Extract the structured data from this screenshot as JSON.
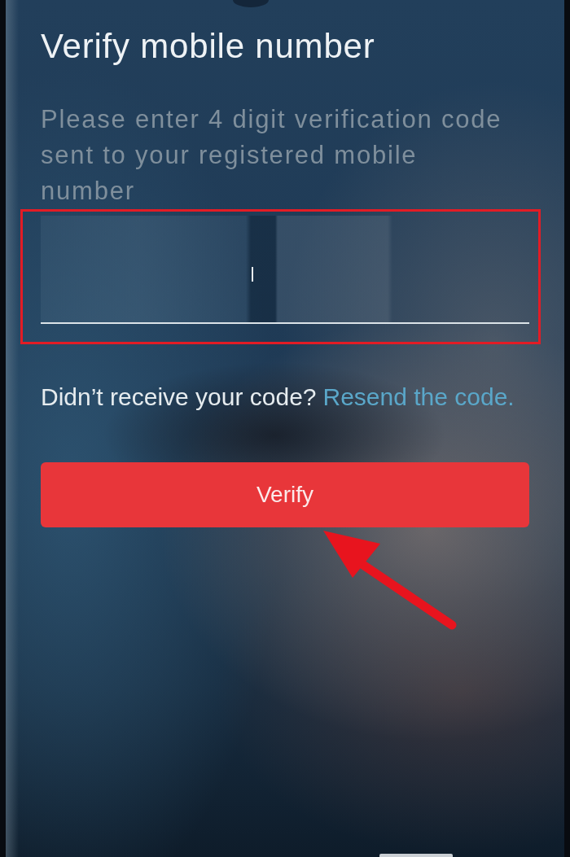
{
  "screen": {
    "title": "Verify mobile number",
    "instructions": "Please enter 4 digit verification code sent to your registered mobile number"
  },
  "code_input": {
    "focused": true,
    "highlighted": true
  },
  "resend": {
    "prompt": "Didn’t receive your code?",
    "link": "Resend the code."
  },
  "verify_button": {
    "label": "Verify",
    "arrow_pointer": true
  }
}
